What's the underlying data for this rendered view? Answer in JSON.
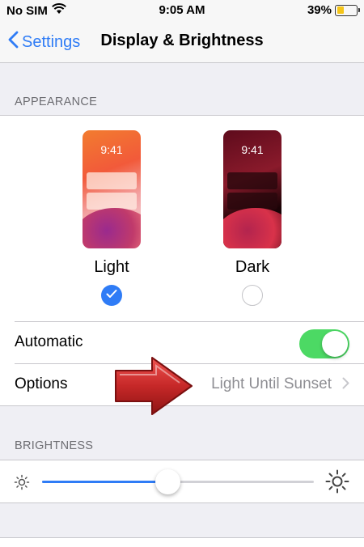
{
  "status_bar": {
    "carrier": "No SIM",
    "time": "9:05 AM",
    "battery": "39%",
    "battery_level": 0.39,
    "battery_color": "#f5c518"
  },
  "nav": {
    "back_label": "Settings",
    "title": "Display & Brightness"
  },
  "appearance": {
    "header": "APPEARANCE",
    "options": [
      {
        "label": "Light",
        "preview_time": "9:41",
        "selected": true
      },
      {
        "label": "Dark",
        "preview_time": "9:41",
        "selected": false
      }
    ],
    "automatic_label": "Automatic",
    "automatic_on": true,
    "options_label": "Options",
    "options_value": "Light Until Sunset"
  },
  "brightness": {
    "header": "BRIGHTNESS",
    "level": 0.47
  },
  "colors": {
    "accent": "#2f7cf6",
    "toggle_on": "#4cd964",
    "annotation_arrow": "#c62828"
  }
}
